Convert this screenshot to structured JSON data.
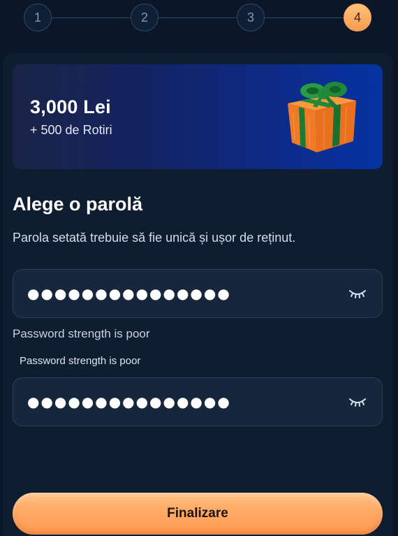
{
  "stepper": {
    "steps": [
      "1",
      "2",
      "3",
      "4"
    ],
    "active_step": "4"
  },
  "banner": {
    "amount": "3,000 Lei",
    "spins": "+ 500 de Rotiri",
    "image": "gift-box"
  },
  "form": {
    "title": "Alege o parolă",
    "subtitle": "Parola setată trebuie să fie unică și ușor de reținut.",
    "password_value": "●●●●●●●●●●●●●●●",
    "confirm_value": "●●●●●●●●●●●●●●●",
    "strength_hint": "Password strength is poor",
    "strength_hint_2": "Password strength is poor",
    "toggle_icon": "eye-closed-icon"
  },
  "actions": {
    "submit_label": "Finalizare"
  },
  "colors": {
    "background": "#0b1728",
    "card": "#0f1d30",
    "accent": "#ff9a52",
    "field": "#16273d"
  }
}
